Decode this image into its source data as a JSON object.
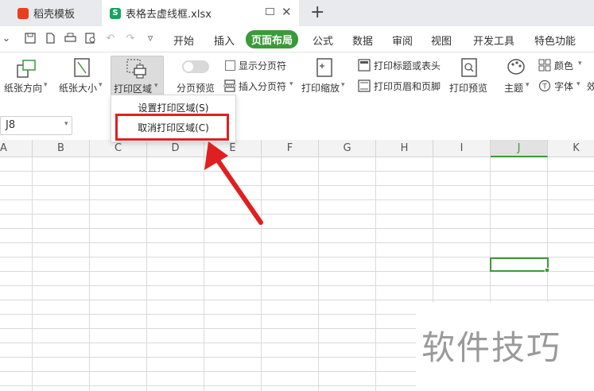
{
  "tabs": [
    {
      "label": "稻壳模板",
      "icon": "wps-logo-icon"
    },
    {
      "label": "表格去虚线框.xlsx",
      "icon": "spreadsheet-file-icon",
      "active": true
    }
  ],
  "new_tab_label": "+",
  "menu": {
    "items": [
      "开始",
      "插入",
      "页面布局",
      "公式",
      "数据",
      "审阅",
      "视图",
      "开发工具",
      "特色功能"
    ],
    "active": "页面布局",
    "accent_color": "#3a9a3a"
  },
  "ribbon": {
    "orientation": "纸张方向",
    "paper_size": "纸张大小",
    "print_area": "打印区域",
    "page_break_preview": "分页预览",
    "show_page_breaks": "显示分页符",
    "insert_page_break": "插入分页符",
    "print_scale": "打印缩放",
    "print_titles": "打印标题或表头",
    "print_header_footer": "打印页眉和页脚",
    "print_preview": "打印预览",
    "theme": "主题",
    "color": "颜色",
    "font": "字体",
    "effects": "效"
  },
  "name_box": {
    "value": "J8"
  },
  "columns": [
    "A",
    "B",
    "C",
    "D",
    "E",
    "F",
    "G",
    "H",
    "I",
    "J",
    "K"
  ],
  "selected_column": "J",
  "selected_cell": "J8",
  "dropdown": {
    "set_print_area": "设置打印区域(S)",
    "cancel_print_area": "取消打印区域(C)"
  },
  "annotation": {
    "highlight_color": "#e02020"
  },
  "watermark": "软件技巧"
}
